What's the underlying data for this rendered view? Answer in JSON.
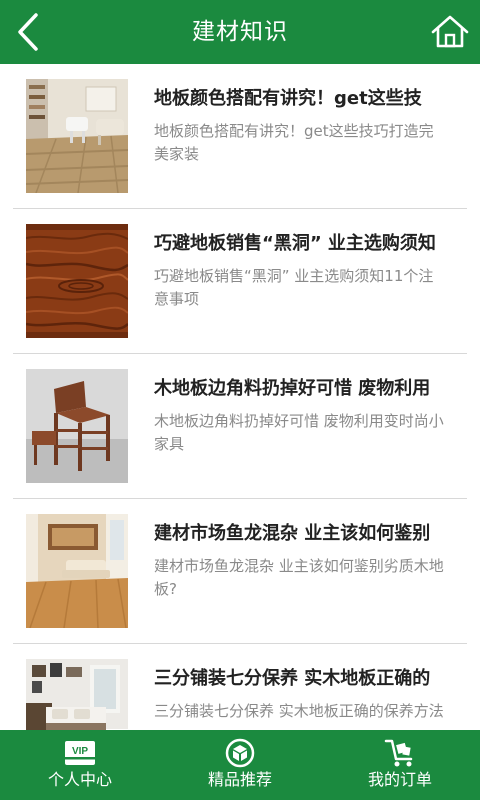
{
  "header": {
    "title": "建材知识",
    "back_icon": "chevron-left-icon",
    "home_icon": "home-icon"
  },
  "articles": [
    {
      "title": "地板颜色搭配有讲究！get这些技",
      "desc": "地板颜色搭配有讲究！get这些技巧打造完美家装",
      "thumb": "living-room-photo"
    },
    {
      "title": "巧避地板销售“黑洞” 业主选购须知",
      "desc": "巧避地板销售“黑洞” 业主选购须知11个注意事项",
      "thumb": "wood-grain-photo"
    },
    {
      "title": "木地板边角料扔掉好可惜 废物利用",
      "desc": "木地板边角料扔掉好可惜 废物利用变时尚小家具",
      "thumb": "wood-chair-photo"
    },
    {
      "title": "建材市场鱼龙混杂 业主该如何鉴别",
      "desc": "建材市场鱼龙混杂 业主该如何鉴别劣质木地板?",
      "thumb": "interior-room-photo"
    },
    {
      "title": "三分铺装七分保养 实木地板正确的",
      "desc": "三分铺装七分保养 实木地板正确的保养方法",
      "thumb": "bedroom-photo"
    }
  ],
  "tabbar": {
    "tabs": [
      {
        "label": "个人中心",
        "icon": "vip-card-icon",
        "icon_text": "VIP"
      },
      {
        "label": "精品推荐",
        "icon": "cube-icon"
      },
      {
        "label": "我的订单",
        "icon": "cart-icon"
      }
    ]
  },
  "colors": {
    "brand_green": "#1b8a3f",
    "title_text": "#222222",
    "desc_text": "#8a8a8a"
  }
}
